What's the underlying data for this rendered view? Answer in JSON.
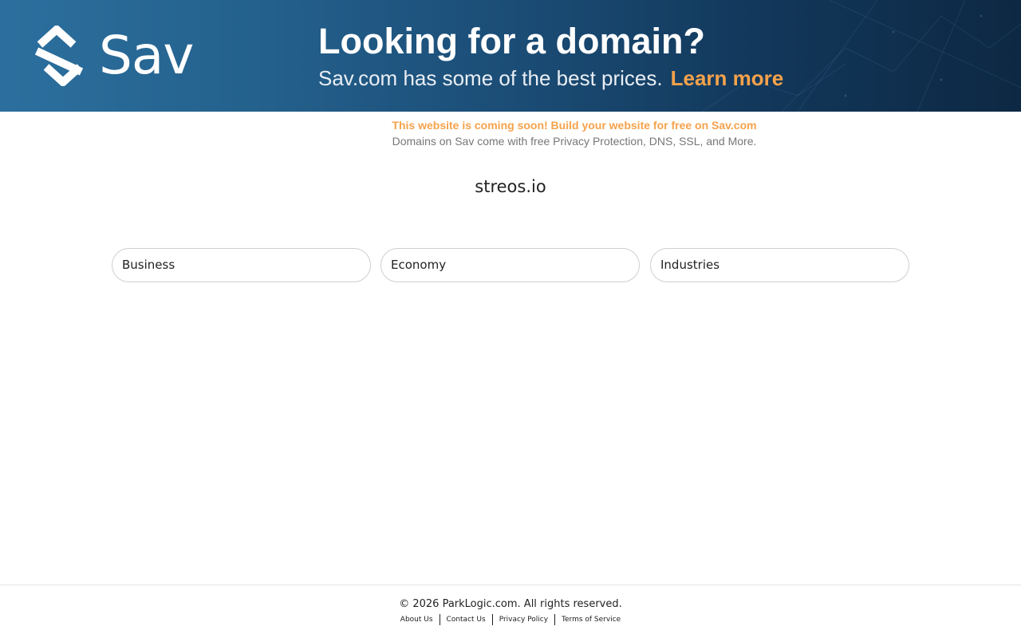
{
  "banner": {
    "logo_text": "Sav",
    "logo_icon": "sav-logo-icon",
    "headline": "Looking for a domain?",
    "subline": "Sav.com has some of the best prices.",
    "cta": "Learn more",
    "accent_color": "#f5a24b"
  },
  "notice": {
    "title": "This website is coming soon! Build your website for free on Sav.com",
    "subtitle": "Domains on Sav come with free Privacy Protection, DNS, SSL, and More."
  },
  "domain_name": "streos.io",
  "related_links": [
    {
      "label": "Business"
    },
    {
      "label": "Economy"
    },
    {
      "label": "Industries"
    }
  ],
  "footer": {
    "copyright": "© 2026 ParkLogic.com. All rights reserved.",
    "links": [
      {
        "label": "About Us"
      },
      {
        "label": "Contact Us"
      },
      {
        "label": "Privacy Policy"
      },
      {
        "label": "Terms of Service"
      }
    ]
  }
}
